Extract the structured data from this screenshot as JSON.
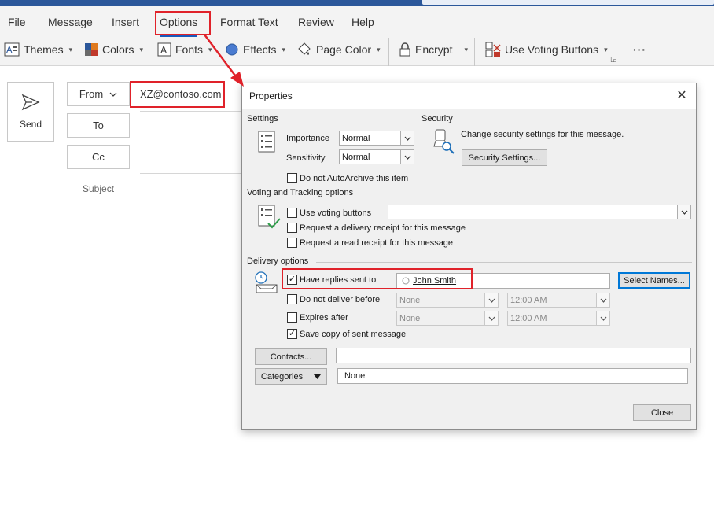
{
  "ribbon": {
    "tabs": [
      "File",
      "Message",
      "Insert",
      "Options",
      "Format Text",
      "Review",
      "Help"
    ],
    "active_tab": "Options",
    "buttons": {
      "themes": "Themes",
      "colors": "Colors",
      "fonts": "Fonts",
      "effects": "Effects",
      "page_color": "Page Color",
      "encrypt": "Encrypt",
      "use_voting_buttons": "Use Voting Buttons",
      "more": "···"
    }
  },
  "compose": {
    "send_label": "Send",
    "from_label": "From",
    "from_value": "XZ@contoso.com",
    "to_label": "To",
    "cc_label": "Cc",
    "subject_label": "Subject"
  },
  "dialog": {
    "title": "Properties",
    "settings": {
      "heading": "Settings",
      "importance_label": "Importance",
      "importance_value": "Normal",
      "sensitivity_label": "Sensitivity",
      "sensitivity_value": "Normal",
      "autoarchive_label": "Do not AutoArchive this item",
      "autoarchive_checked": false
    },
    "security": {
      "heading": "Security",
      "description": "Change security settings for this message.",
      "button": "Security Settings..."
    },
    "voting": {
      "heading": "Voting and Tracking options",
      "use_voting_label": "Use voting buttons",
      "use_voting_checked": false,
      "voting_value": "",
      "delivery_receipt_label": "Request a delivery receipt for this message",
      "read_receipt_label": "Request a read receipt for this message"
    },
    "delivery": {
      "heading": "Delivery options",
      "replies_label": "Have replies sent to",
      "replies_checked": true,
      "replies_to": "John Smith",
      "select_names_button": "Select Names...",
      "no_deliver_label": "Do not deliver before",
      "no_deliver_date": "None",
      "no_deliver_time": "12:00 AM",
      "expires_label": "Expires after",
      "expires_date": "None",
      "expires_time": "12:00 AM",
      "save_copy_label": "Save copy of sent message",
      "save_copy_checked": true
    },
    "contacts_button": "Contacts...",
    "contacts_value": "",
    "categories_button": "Categories",
    "categories_value": "None",
    "close_button": "Close",
    "close_x": "✕"
  },
  "colors": {
    "accent": "#185abd",
    "annotation_red": "#e0222a",
    "title_bar": "#2b579a"
  },
  "icons": [
    "send-icon",
    "chevron-down-icon",
    "themes-icon",
    "colors-icon",
    "fonts-icon",
    "effects-icon",
    "page-color-icon",
    "lock-icon",
    "voting-icon",
    "settings-list-icon",
    "security-key-icon",
    "voting-checklist-icon",
    "delivery-clock-icon",
    "contact-circle-icon"
  ]
}
